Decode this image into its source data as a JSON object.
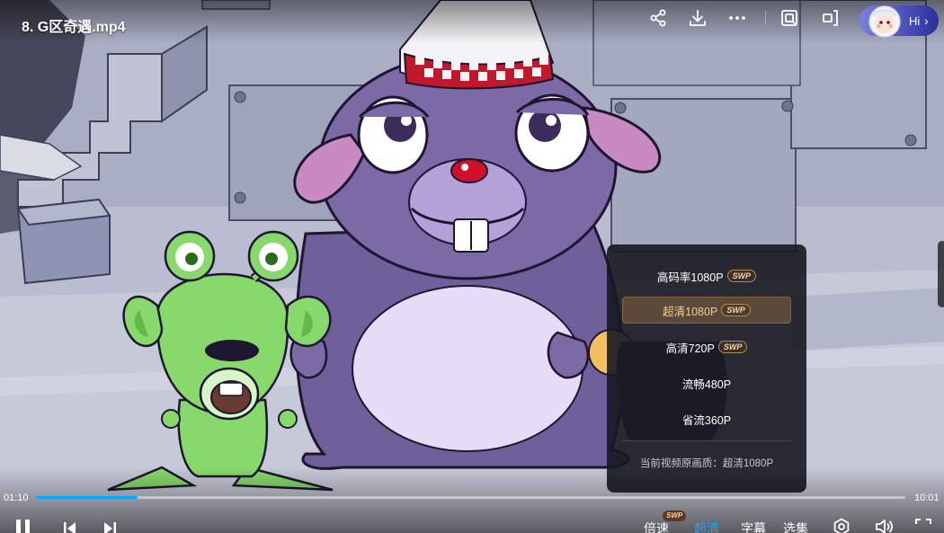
{
  "video": {
    "title": "8. G区奇遇.mp4"
  },
  "top_actions": {
    "icons": [
      "share-icon",
      "download-icon",
      "more-icon",
      "screenshot-icon",
      "picture-in-picture-icon"
    ],
    "assistant_label": "Hi"
  },
  "quality_menu": {
    "options": [
      {
        "label": "高码率1080P",
        "badge": "SWP",
        "selected": false
      },
      {
        "label": "超清1080P",
        "badge": "SWP",
        "selected": true
      },
      {
        "label": "高清720P",
        "badge": "SWP",
        "selected": false
      },
      {
        "label": "流畅480P",
        "badge": "",
        "selected": false
      },
      {
        "label": "省流360P",
        "badge": "",
        "selected": false
      }
    ],
    "footer": "当前视频原画质：超清1080P"
  },
  "player": {
    "current_time": "01:10",
    "total_time": "10:01",
    "progress_fraction": 0.1164,
    "speed_label": "倍速",
    "speed_badge": "SWP",
    "quality_label": "超清",
    "subtitle_label": "字幕",
    "episodes_label": "选集"
  },
  "colors": {
    "accent": "#1aa3ff",
    "progress": "#06a7ff",
    "selected_text": "#f1cc94"
  }
}
